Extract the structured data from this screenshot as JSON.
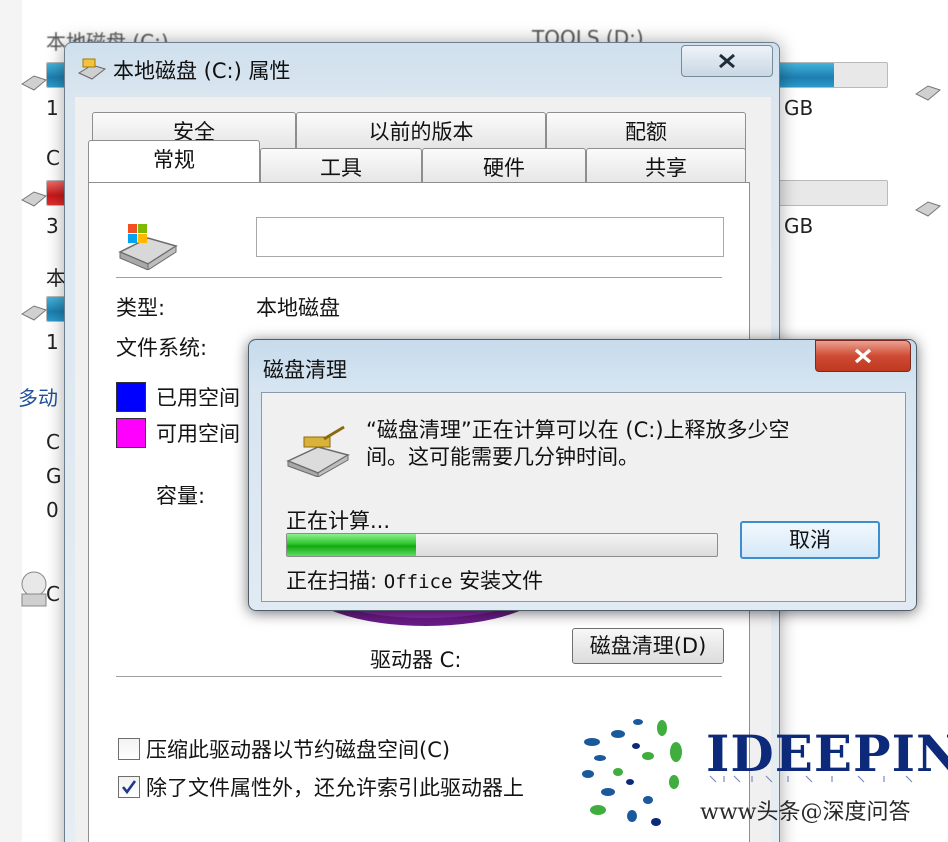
{
  "background": {
    "drive_c_label": "本地磁盘 (C:)",
    "drive_d_label": "TOOLS (D:)",
    "size_gb_1": "GB",
    "size_gb_2": "GB",
    "partial_1": "1",
    "partial_c": "C",
    "partial_3": "3",
    "partial_ben": "本",
    "partial_1b": "1",
    "section_removable": "多动",
    "partial_c2": "C",
    "partial_g": "G",
    "partial_0": "0",
    "partial_c3": "C",
    "used_fraction_c": 0.08,
    "used_fraction_d": 0.85,
    "used_fraction_red": 0.06
  },
  "properties": {
    "title": "本地磁盘 (C:) 属性",
    "tabs_back": [
      "安全",
      "以前的版本",
      "配额"
    ],
    "tabs_front": [
      "常规",
      "工具",
      "硬件",
      "共享"
    ],
    "active_tab": "常规",
    "type_label": "类型:",
    "type_value": "本地磁盘",
    "fs_label": "文件系统:",
    "used_label": "已用空间",
    "free_label": "可用空间",
    "capacity_label": "容量:",
    "drive_label": "驱动器 C:",
    "cleanup_button": "磁盘清理(D)",
    "compress_label": "压缩此驱动器以节约磁盘空间(C)",
    "compress_checked": false,
    "index_label": "除了文件属性外，还允许索引此驱动器上",
    "index_checked": true,
    "colors": {
      "used": "#0000ff",
      "free": "#ff00ff"
    }
  },
  "cleanup": {
    "title": "磁盘清理",
    "message_line1": "“磁盘清理”正在计算可以在 (C:)上释放多少空",
    "message_line2": "间。这可能需要几分钟时间。",
    "calculating_label": "正在计算...",
    "progress_fraction": 0.3,
    "cancel_button": "取消",
    "scanning_prefix": "正在扫描:",
    "scanning_item_mono": "Office",
    "scanning_item_rest": "安装文件"
  },
  "watermark": {
    "brand": "IDEEPIN",
    "credit": "www头条@深度问答"
  }
}
